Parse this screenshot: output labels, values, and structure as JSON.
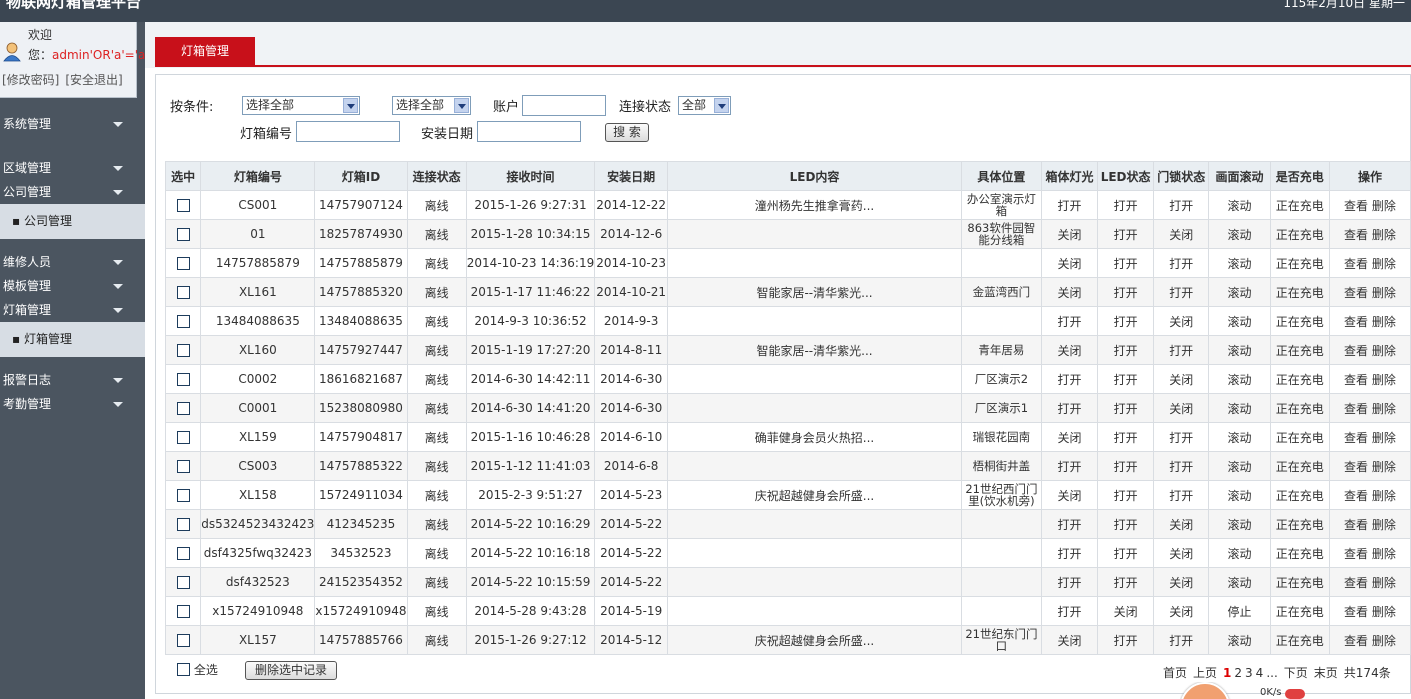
{
  "app": {
    "title": "物联网灯箱管理平台",
    "date": "115年2月10日 星期一"
  },
  "user": {
    "welcome": "欢迎",
    "you_label": "您：",
    "username": "admin'OR'a'='a",
    "change_password": "[修改密码]",
    "logout": "[安全退出]"
  },
  "menu": {
    "system": "系统管理",
    "region": "区域管理",
    "company": "公司管理",
    "company_sub": "▪ 公司管理",
    "repair": "维修人员",
    "template": "模板管理",
    "lightbox": "灯箱管理",
    "lightbox_sub": "▪ 灯箱管理",
    "alarm": "报警日志",
    "attendance": "考勤管理"
  },
  "tab": {
    "label": "灯箱管理"
  },
  "search": {
    "conditions_label": "按条件:",
    "select1": "选择全部",
    "select2": "选择全部",
    "account_label": "账户",
    "conn_label": "连接状态",
    "conn_value": "全部",
    "box_no_label": "灯箱编号",
    "install_date_label": "安装日期",
    "search_button": "搜 索"
  },
  "table": {
    "headers": [
      "选中",
      "灯箱编号",
      "灯箱ID",
      "连接状态",
      "接收时间",
      "安装日期",
      "LED内容",
      "具体位置",
      "箱体灯光",
      "LED状态",
      "门锁状态",
      "画面滚动",
      "是否充电",
      "操作"
    ],
    "view_label": "查看",
    "delete_label": "删除",
    "rows": [
      [
        "CS001",
        "14757907124",
        "离线",
        "2015-1-26 9:27:31",
        "2014-12-22",
        "潼州杨先生推拿膏药...",
        "办公室演示灯箱",
        "打开",
        "打开",
        "打开",
        "滚动",
        "正在充电"
      ],
      [
        "01",
        "18257874930",
        "离线",
        "2015-1-28 10:34:15",
        "2014-12-6",
        "",
        "863软件园智能分线箱",
        "关闭",
        "打开",
        "关闭",
        "滚动",
        "正在充电"
      ],
      [
        "14757885879",
        "14757885879",
        "离线",
        "2014-10-23 14:36:19",
        "2014-10-23",
        "",
        "",
        "关闭",
        "打开",
        "打开",
        "滚动",
        "正在充电"
      ],
      [
        "XL161",
        "14757885320",
        "离线",
        "2015-1-17 11:46:22",
        "2014-10-21",
        "智能家居--清华紫光...",
        "金蓝湾西门",
        "关闭",
        "打开",
        "打开",
        "滚动",
        "正在充电"
      ],
      [
        "13484088635",
        "13484088635",
        "离线",
        "2014-9-3 10:36:52",
        "2014-9-3",
        "",
        "",
        "打开",
        "打开",
        "关闭",
        "滚动",
        "正在充电"
      ],
      [
        "XL160",
        "14757927447",
        "离线",
        "2015-1-19 17:27:20",
        "2014-8-11",
        "智能家居--清华紫光...",
        "青年居易",
        "关闭",
        "打开",
        "打开",
        "滚动",
        "正在充电"
      ],
      [
        "C0002",
        "18616821687",
        "离线",
        "2014-6-30 14:42:11",
        "2014-6-30",
        "",
        "厂区演示2",
        "打开",
        "打开",
        "关闭",
        "滚动",
        "正在充电"
      ],
      [
        "C0001",
        "15238080980",
        "离线",
        "2014-6-30 14:41:20",
        "2014-6-30",
        "",
        "厂区演示1",
        "打开",
        "打开",
        "关闭",
        "滚动",
        "正在充电"
      ],
      [
        "XL159",
        "14757904817",
        "离线",
        "2015-1-16 10:46:28",
        "2014-6-10",
        "确菲健身会员火热招...",
        "瑞银花园南",
        "关闭",
        "打开",
        "打开",
        "滚动",
        "正在充电"
      ],
      [
        "CS003",
        "14757885322",
        "离线",
        "2015-1-12 11:41:03",
        "2014-6-8",
        "",
        "梧桐街井盖",
        "打开",
        "打开",
        "打开",
        "滚动",
        "正在充电"
      ],
      [
        "XL158",
        "15724911034",
        "离线",
        "2015-2-3 9:51:27",
        "2014-5-23",
        "庆祝超越健身会所盛...",
        "21世纪西门门里(饮水机旁)",
        "关闭",
        "打开",
        "打开",
        "滚动",
        "正在充电"
      ],
      [
        "ds5324523432423",
        "412345235",
        "离线",
        "2014-5-22 10:16:29",
        "2014-5-22",
        "",
        "",
        "打开",
        "打开",
        "关闭",
        "滚动",
        "正在充电"
      ],
      [
        "dsf4325fwq32423",
        "34532523",
        "离线",
        "2014-5-22 10:16:18",
        "2014-5-22",
        "",
        "",
        "打开",
        "打开",
        "关闭",
        "滚动",
        "正在充电"
      ],
      [
        "dsf432523",
        "24152354352",
        "离线",
        "2014-5-22 10:15:59",
        "2014-5-22",
        "",
        "",
        "打开",
        "打开",
        "关闭",
        "滚动",
        "正在充电"
      ],
      [
        "x15724910948",
        "x15724910948",
        "离线",
        "2014-5-28 9:43:28",
        "2014-5-19",
        "",
        "",
        "打开",
        "关闭",
        "关闭",
        "停止",
        "正在充电"
      ],
      [
        "XL157",
        "14757885766",
        "离线",
        "2015-1-26 9:27:12",
        "2014-5-12",
        "庆祝超越健身会所盛...",
        "21世纪东门门口",
        "关闭",
        "打开",
        "打开",
        "滚动",
        "正在充电"
      ]
    ]
  },
  "footer": {
    "select_all": "全选",
    "delete_selected": "删除选中记录"
  },
  "pagination": {
    "first": "首页",
    "prev": "上页",
    "current": "1",
    "pages": [
      "2",
      "3",
      "4"
    ],
    "ellipsis": "...",
    "next": "下页",
    "last": "末页",
    "total": "共174条"
  },
  "widget": {
    "percent": "0K/s"
  }
}
